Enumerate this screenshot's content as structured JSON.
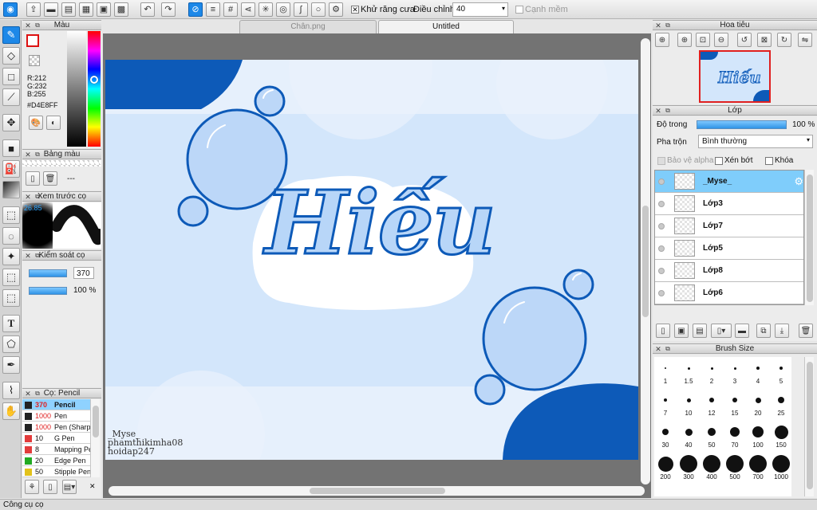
{
  "toolbar": {
    "antialias_label": "Khử răng cưa",
    "adjust_label": "Điều chỉnh",
    "adjust_value": "40",
    "smooth_label": "Cạnh mềm"
  },
  "tabs": [
    "Chân.png",
    "Untitled"
  ],
  "color_panel": {
    "title": "Màu",
    "r": "R:212",
    "g": "G:232",
    "b": "B:255",
    "hex": "#D4E8FF",
    "current_color": "#D4E8FF"
  },
  "palette_panel": {
    "title": "Bảng màu",
    "empty_label": "---"
  },
  "preview_panel": {
    "title": "Xem trước cọ",
    "size_label": "26.85"
  },
  "brush_control": {
    "title": "Kiểm soát cọ",
    "size_value": "370",
    "opacity_value": "100 %"
  },
  "brush_panel": {
    "title": "Cọ: Pencil",
    "items": [
      {
        "size": "370",
        "name": "Pencil",
        "color": "#222222",
        "size_red": true
      },
      {
        "size": "1000",
        "name": "Pen",
        "color": "#222222",
        "size_red": true
      },
      {
        "size": "1000",
        "name": "Pen (Sharp)",
        "color": "#222222",
        "size_red": true
      },
      {
        "size": "10",
        "name": "G Pen",
        "color": "#e23b3b",
        "size_red": false
      },
      {
        "size": "8",
        "name": "Mapping Pen",
        "color": "#e23b3b",
        "size_red": false
      },
      {
        "size": "20",
        "name": "Edge Pen",
        "color": "#22aa22",
        "size_red": false
      },
      {
        "size": "50",
        "name": "Stipple Pen",
        "color": "#e2c21b",
        "size_red": false
      }
    ]
  },
  "canvas": {
    "title_text": "Hiếu",
    "watermark": [
      "_Myse_",
      "phamthikimha08",
      "hoidap247"
    ]
  },
  "navigator": {
    "title": "Hoa tiêu"
  },
  "layer_panel": {
    "title": "Lớp",
    "opacity_label": "Độ trong",
    "opacity_value": "100 %",
    "blend_label": "Pha trộn",
    "blend_value": "Bình thường",
    "protect_alpha": "Bảo vệ alpha",
    "clipping": "Xén bớt",
    "lock": "Khóa",
    "layers": [
      {
        "name": "_Myse_"
      },
      {
        "name": "Lớp3"
      },
      {
        "name": "Lớp7"
      },
      {
        "name": "Lớp5"
      },
      {
        "name": "Lớp8"
      },
      {
        "name": "Lớp6"
      }
    ]
  },
  "brush_size_panel": {
    "title": "Brush Size",
    "sizes": [
      "1",
      "1.5",
      "2",
      "3",
      "4",
      "5",
      "7",
      "10",
      "12",
      "15",
      "20",
      "25",
      "30",
      "40",
      "50",
      "70",
      "100",
      "150",
      "200",
      "300",
      "400",
      "500",
      "700",
      "1000"
    ]
  },
  "status": {
    "text": "Công cụ cọ"
  }
}
